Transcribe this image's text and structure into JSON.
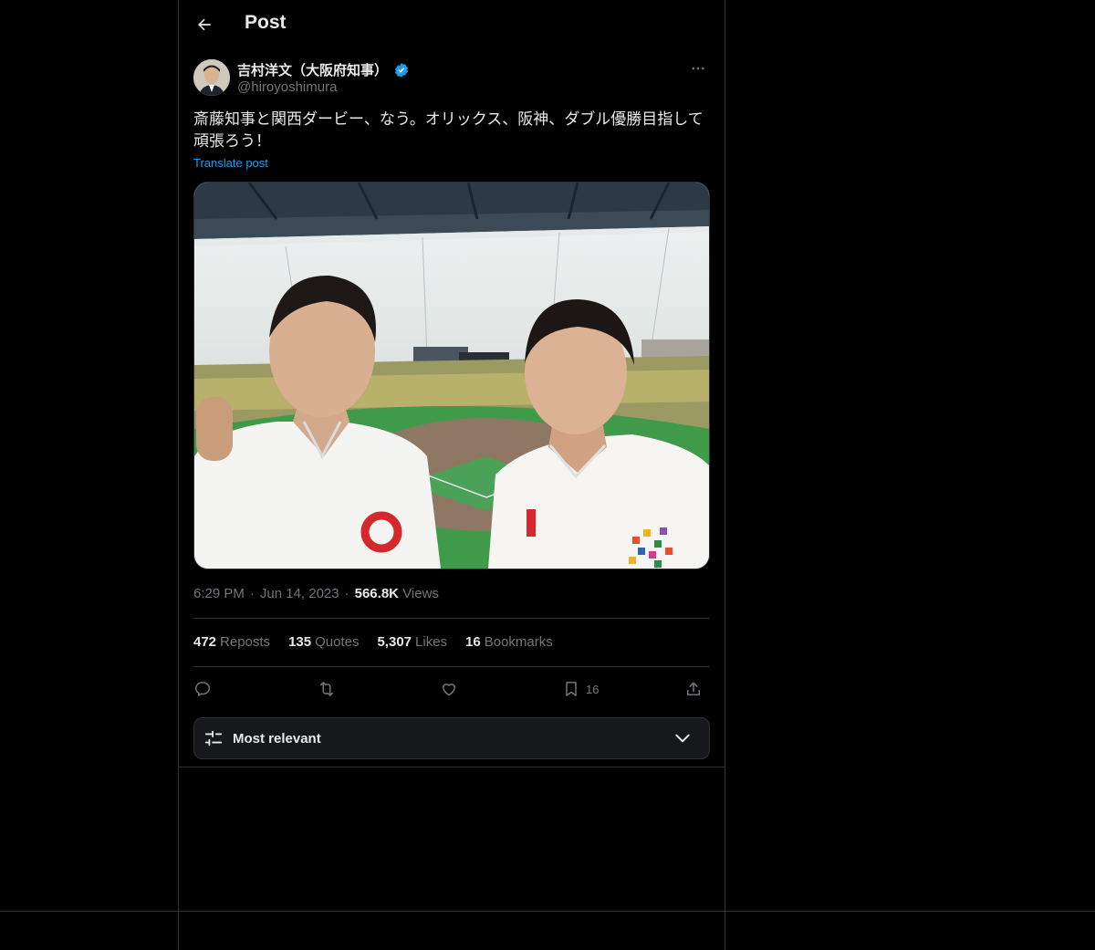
{
  "header": {
    "title": "Post"
  },
  "author": {
    "name": "吉村洋文（大阪府知事）",
    "handle": "@hiroyoshimura"
  },
  "post": {
    "text": "斎藤知事と関西ダービー、なう。オリックス、阪神、ダブル優勝目指して頑張ろう！",
    "translate_label": "Translate post"
  },
  "meta": {
    "time": "6:29 PM",
    "separator": "·",
    "date": "Jun 14, 2023",
    "views_count": "566.8K",
    "views_label": "Views"
  },
  "stats": {
    "reposts_count": "472",
    "reposts_label": "Reposts",
    "quotes_count": "135",
    "quotes_label": "Quotes",
    "likes_count": "5,307",
    "likes_label": "Likes",
    "bookmarks_count": "16",
    "bookmarks_label": "Bookmarks"
  },
  "actions": {
    "bookmark_count": "16"
  },
  "sort": {
    "label": "Most relevant"
  },
  "icons": [
    "back-arrow-icon",
    "verified-badge-icon",
    "more-icon",
    "reply-icon",
    "repost-icon",
    "like-icon",
    "bookmark-icon",
    "share-icon",
    "tune-icon",
    "chevron-down-icon"
  ],
  "colors": {
    "background": "#000000",
    "text": "#e7e9ea",
    "muted": "#71767b",
    "accent": "#1d9bf0",
    "border": "#2f3336"
  }
}
